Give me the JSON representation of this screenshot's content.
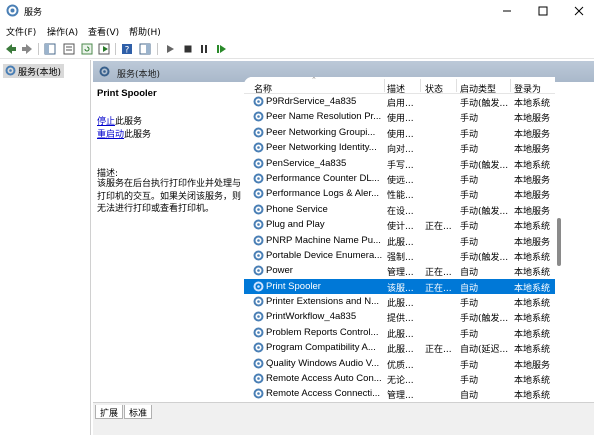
{
  "window": {
    "title": "服务",
    "min_label": "—",
    "max_label": "☐",
    "close_label": "✕"
  },
  "menu": [
    "文件(F)",
    "操作(A)",
    "查看(V)",
    "帮助(H)"
  ],
  "toolbar": {
    "icons": [
      "back-icon",
      "forward-icon",
      "show-console-tree-icon",
      "properties-icon",
      "refresh-icon",
      "export-list-icon",
      "help-icon",
      "show-action-pane-icon",
      "start-service-icon",
      "stop-service-icon",
      "pause-service-icon",
      "restart-service-icon"
    ]
  },
  "tree": {
    "root_label": "服务(本地)"
  },
  "pane_header": {
    "label": "服务(本地)"
  },
  "details": {
    "service_title": "Print Spooler",
    "stop_link": "停止",
    "stop_suffix": "此服务",
    "restart_link": "重启动",
    "restart_suffix": "此服务",
    "desc_label": "描述:",
    "desc_text": "该服务在后台执行打印作业并处理与打印机的交互。如果关闭该服务，则无法进行打印或查看打印机。"
  },
  "columns": [
    "名称",
    "描述",
    "状态",
    "启动类型",
    "登录为"
  ],
  "rows": [
    {
      "name": "P9RdrService_4a835",
      "desc": "启用...",
      "status": "",
      "startup": "手动(触发...",
      "logon": "本地系统"
    },
    {
      "name": "Peer Name Resolution Pr...",
      "desc": "使用...",
      "status": "",
      "startup": "手动",
      "logon": "本地服务"
    },
    {
      "name": "Peer Networking Groupi...",
      "desc": "使用...",
      "status": "",
      "startup": "手动",
      "logon": "本地服务"
    },
    {
      "name": "Peer Networking Identity...",
      "desc": "向对...",
      "status": "",
      "startup": "手动",
      "logon": "本地服务"
    },
    {
      "name": "PenService_4a835",
      "desc": "手写...",
      "status": "",
      "startup": "手动(触发...",
      "logon": "本地系统"
    },
    {
      "name": "Performance Counter DL...",
      "desc": "使远...",
      "status": "",
      "startup": "手动",
      "logon": "本地服务"
    },
    {
      "name": "Performance Logs & Aler...",
      "desc": "性能...",
      "status": "",
      "startup": "手动",
      "logon": "本地服务"
    },
    {
      "name": "Phone Service",
      "desc": "在设...",
      "status": "",
      "startup": "手动(触发...",
      "logon": "本地服务"
    },
    {
      "name": "Plug and Play",
      "desc": "使计...",
      "status": "正在...",
      "startup": "手动",
      "logon": "本地系统"
    },
    {
      "name": "PNRP Machine Name Pu...",
      "desc": "此服...",
      "status": "",
      "startup": "手动",
      "logon": "本地服务"
    },
    {
      "name": "Portable Device Enumera...",
      "desc": "强制...",
      "status": "",
      "startup": "手动(触发...",
      "logon": "本地系统"
    },
    {
      "name": "Power",
      "desc": "管理...",
      "status": "正在...",
      "startup": "自动",
      "logon": "本地系统"
    },
    {
      "name": "Print Spooler",
      "desc": "该服...",
      "status": "正在...",
      "startup": "自动",
      "logon": "本地系统",
      "selected": true
    },
    {
      "name": "Printer Extensions and N...",
      "desc": "此服...",
      "status": "",
      "startup": "手动",
      "logon": "本地系统"
    },
    {
      "name": "PrintWorkflow_4a835",
      "desc": "提供...",
      "status": "",
      "startup": "手动(触发...",
      "logon": "本地系统"
    },
    {
      "name": "Problem Reports Control...",
      "desc": "此服...",
      "status": "",
      "startup": "手动",
      "logon": "本地系统"
    },
    {
      "name": "Program Compatibility A...",
      "desc": "此服...",
      "status": "正在...",
      "startup": "自动(延迟...",
      "logon": "本地系统"
    },
    {
      "name": "Quality Windows Audio V...",
      "desc": "优质...",
      "status": "",
      "startup": "手动",
      "logon": "本地服务"
    },
    {
      "name": "Remote Access Auto Con...",
      "desc": "无论...",
      "status": "",
      "startup": "手动",
      "logon": "本地系统"
    },
    {
      "name": "Remote Access Connecti...",
      "desc": "管理...",
      "status": "",
      "startup": "自动",
      "logon": "本地系统"
    }
  ],
  "tabs": [
    "扩展",
    "标准"
  ],
  "colors": {
    "selection": "#0078d7",
    "link": "#0000cc",
    "header_gradient": "#b2c1d2"
  }
}
